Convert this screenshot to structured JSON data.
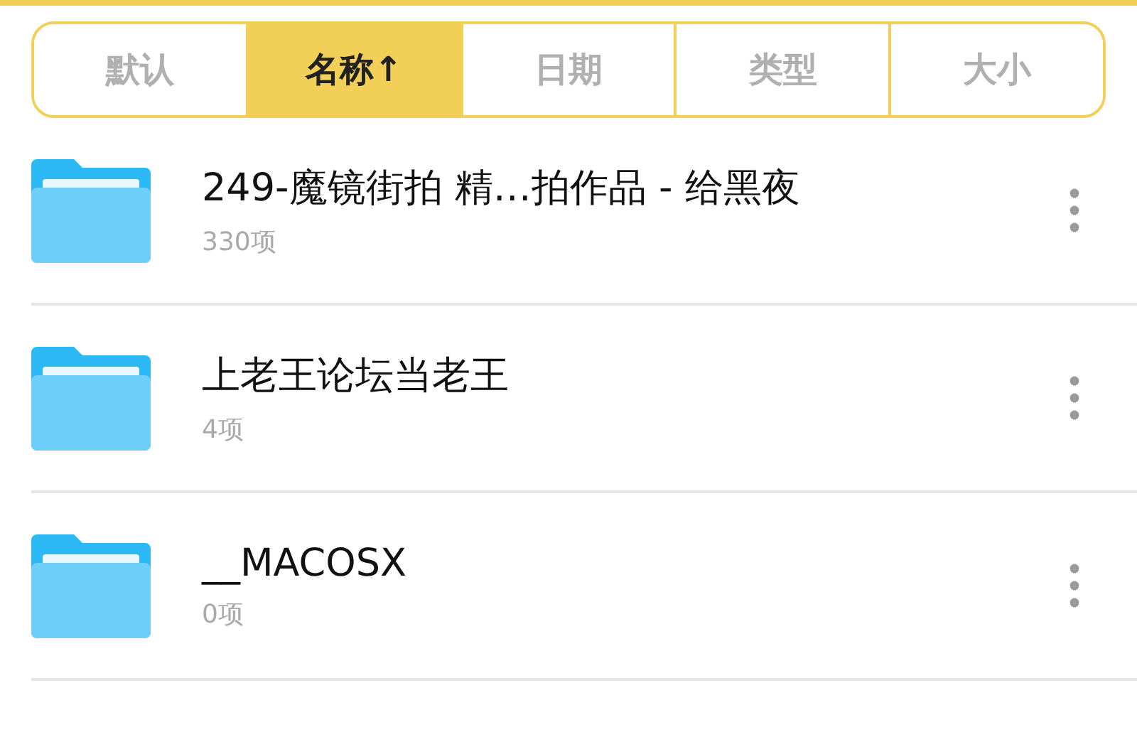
{
  "sort_tabs": [
    {
      "label": "默认",
      "selected": false
    },
    {
      "label": "名称↑",
      "selected": true
    },
    {
      "label": "日期",
      "selected": false
    },
    {
      "label": "类型",
      "selected": false
    },
    {
      "label": "大小",
      "selected": false
    }
  ],
  "files": [
    {
      "name": "249-魔镜街拍 精…拍作品 - 给黑夜",
      "count": "330项"
    },
    {
      "name": "上老王论坛当老王",
      "count": "4项"
    },
    {
      "name": "__MACOSX",
      "count": "0项"
    }
  ]
}
